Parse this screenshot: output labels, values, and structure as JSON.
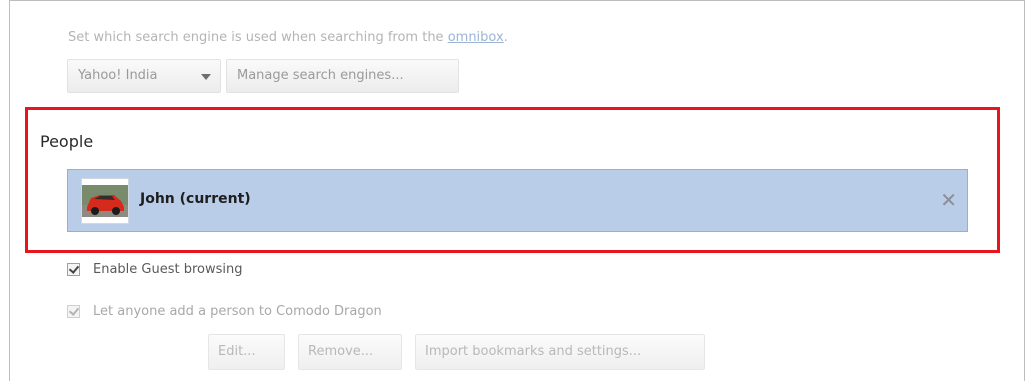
{
  "search": {
    "description_prefix": "Set which search engine is used when searching from the ",
    "omnibox_link": "omnibox",
    "description_suffix": ".",
    "engine_selected": "Yahoo! India",
    "manage_label": "Manage search engines..."
  },
  "people": {
    "title": "People",
    "profiles": [
      {
        "name": "John (current)",
        "avatar_icon": "red-car-photo"
      }
    ],
    "remove_glyph": "✕",
    "enable_guest_label": "Enable Guest browsing",
    "enable_guest_checked": true,
    "let_anyone_label": "Let anyone add a person to Comodo Dragon",
    "let_anyone_checked": true,
    "buttons": {
      "edit": "Edit...",
      "remove": "Remove...",
      "import": "Import bookmarks and settings..."
    }
  },
  "colors": {
    "highlight_border": "#e8141e",
    "selected_row": "#b9cce8",
    "link": "#9cb4d4"
  }
}
